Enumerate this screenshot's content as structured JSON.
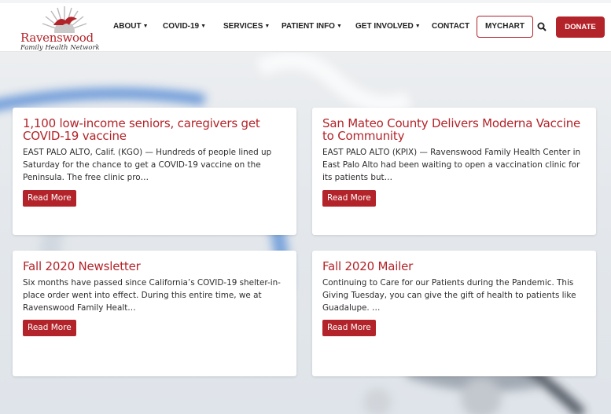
{
  "logo": {
    "name": "Ravenswood",
    "tagline": "Family Health Network"
  },
  "nav": {
    "items": [
      {
        "label": "ABOUT",
        "has_dropdown": true
      },
      {
        "label": "COVID-19",
        "has_dropdown": true
      },
      {
        "label": "SERVICES",
        "has_dropdown": true
      },
      {
        "label": "PATIENT INFO",
        "has_dropdown": true
      },
      {
        "label": "GET INVOLVED",
        "has_dropdown": true
      },
      {
        "label": "CONTACT",
        "has_dropdown": false
      }
    ],
    "mychart_label": "MYCHART",
    "search_icon": "search-icon",
    "donate_label": "DONATE"
  },
  "colors": {
    "brand": "#b3242a",
    "text": "#2d2d2d"
  },
  "cards": [
    {
      "title": "1,100 low-income seniors, caregivers get COVID-19 vaccine",
      "excerpt": "EAST PALO ALTO, Calif. (KGO) — Hundreds of people lined up Saturday for the chance to get a COVID-19 vaccine on the Peninsula. The free clinic pro…",
      "button": "Read More"
    },
    {
      "title": "San Mateo County Delivers Moderna Vaccine to Community",
      "excerpt": "EAST PALO ALTO (KPIX) — Ravenswood Family Health Center in East Palo Alto  had been waiting to open a vaccination clinic for its patients but…",
      "button": "Read More"
    },
    {
      "title": "Fall 2020 Newsletter",
      "excerpt": "Six months have passed since California’s COVID-19 shelter-in-place order went into effect. During this entire time, we at Ravenswood Family Healt…",
      "button": "Read More"
    },
    {
      "title": "Fall 2020 Mailer",
      "excerpt": "Continuing to Care for our Patients during the Pandemic. This Giving Tuesday, you can give the gift of health to patients like Guadalupe. …",
      "button": "Read More"
    }
  ]
}
